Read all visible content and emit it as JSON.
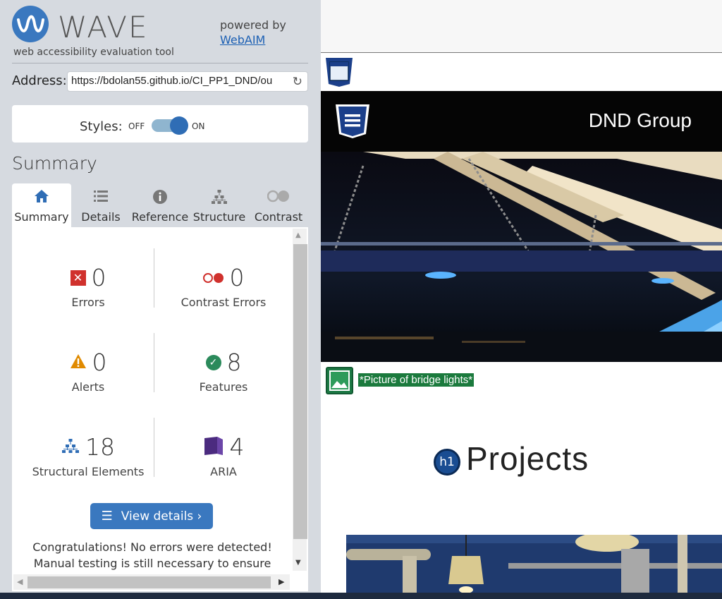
{
  "app": {
    "logo_word": "WAVE",
    "tagline": "web accessibility evaluation tool",
    "powered_by": "powered by",
    "webaim_link": "WebAIM"
  },
  "address": {
    "label": "Address:",
    "value": "https://bdolan55.github.io/CI_PP1_DND/ou",
    "reload_icon": "reload-icon"
  },
  "styles": {
    "label": "Styles:",
    "off": "OFF",
    "on": "ON",
    "state": "on"
  },
  "summary_heading": "Summary",
  "tabs": [
    {
      "label": "Summary",
      "icon": "home-icon",
      "active": true
    },
    {
      "label": "Details",
      "icon": "list-icon",
      "active": false
    },
    {
      "label": "Reference",
      "icon": "info-icon",
      "active": false
    },
    {
      "label": "Structure",
      "icon": "structure-icon",
      "active": false
    },
    {
      "label": "Contrast",
      "icon": "contrast-icon",
      "active": false
    }
  ],
  "stats": {
    "errors": {
      "count": "0",
      "label": "Errors"
    },
    "contrast_errors": {
      "count": "0",
      "label": "Contrast Errors"
    },
    "alerts": {
      "count": "0",
      "label": "Alerts"
    },
    "features": {
      "count": "8",
      "label": "Features"
    },
    "structural": {
      "count": "18",
      "label": "Structural Elements"
    },
    "aria": {
      "count": "4",
      "label": "ARIA"
    }
  },
  "view_details_button": "View details ›",
  "congrats_line1": "Congratulations! No errors were detected!",
  "congrats_line2": "Manual testing is still necessary to ensure",
  "preview": {
    "brand": "DND Group",
    "alt_text": "*Picture of bridge lights*",
    "h1_badge": "h1",
    "heading": "Projects"
  },
  "colors": {
    "accent": "#3a78bf",
    "error": "#d0312d",
    "feature": "#2b8a5b",
    "alert": "#e08a00",
    "aria": "#4b2b7f"
  }
}
